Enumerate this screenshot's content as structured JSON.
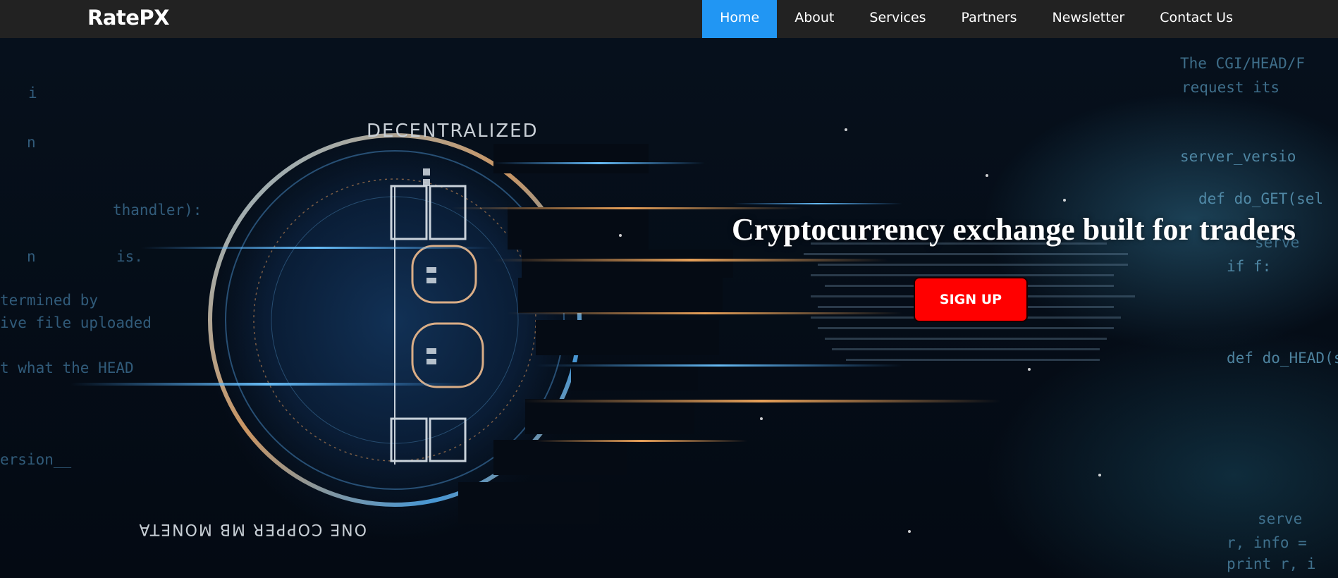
{
  "brand": {
    "name": "RatePX"
  },
  "nav": {
    "items": [
      {
        "label": "Home",
        "active": true
      },
      {
        "label": "About",
        "active": false
      },
      {
        "label": "Services",
        "active": false
      },
      {
        "label": "Partners",
        "active": false
      },
      {
        "label": "Newsletter",
        "active": false
      },
      {
        "label": "Contact Us",
        "active": false
      }
    ]
  },
  "hero": {
    "headline": "Cryptocurrency exchange built for traders",
    "cta_label": "SIGN UP",
    "background_image": "bitcoin-coin-digital-code-icon",
    "background_text": {
      "line1": "i",
      "line2": "n",
      "line3": "thandler):",
      "line4": "n",
      "line5": "is.",
      "line6": "termined by",
      "line7": "ive file uploaded",
      "line8": "t what the HEAD",
      "line9": "ersion__",
      "right1": "The CGI/HEAD/F",
      "right2": "request  its",
      "right3": "server_versio",
      "right4": "def do_GET(sel",
      "right5": "if f:",
      "right6": "serve",
      "right7": "def do_HEAD(s",
      "right8": "serve",
      "right9": "r, info =",
      "right10": "print r, i",
      "coin_top": "DECENTRALIZED",
      "coin_bottom": "ONE COPPER MB MONETA"
    }
  },
  "colors": {
    "navbar_bg": "#222222",
    "nav_active": "#2196f3",
    "cta_bg": "#ff0000",
    "hero_bg": "#050b14"
  }
}
